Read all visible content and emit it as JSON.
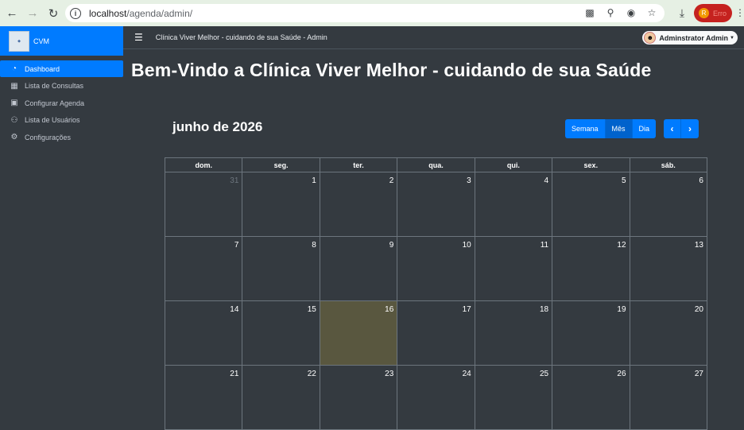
{
  "browser": {
    "url_host": "localhost",
    "url_path": "/agenda/admin/",
    "profile_initial": "R",
    "profile_label": "Erro"
  },
  "sidebar": {
    "brand": "CVM",
    "items": [
      {
        "label": "Dashboard",
        "icon": "dashboard-icon",
        "active": true
      },
      {
        "label": "Lista de Consultas",
        "icon": "calendar-icon",
        "active": false
      },
      {
        "label": "Configurar Agenda",
        "icon": "calendar-edit-icon",
        "active": false
      },
      {
        "label": "Lista de Usuários",
        "icon": "users-icon",
        "active": false
      },
      {
        "label": "Configurações",
        "icon": "gears-icon",
        "active": false
      }
    ]
  },
  "topbar": {
    "title": "Clínica Viver Melhor - cuidando de sua Saúde - Admin",
    "user_name": "Adminstrator Admin"
  },
  "page": {
    "title": "Bem-Vindo a Clínica Viver Melhor - cuidando de sua Saúde"
  },
  "calendar": {
    "title": "junho de 2026",
    "view_buttons": [
      "Semana",
      "Mês",
      "Dia"
    ],
    "active_view": "Mês",
    "weekdays": [
      "dom.",
      "seg.",
      "ter.",
      "qua.",
      "qui.",
      "sex.",
      "sáb."
    ],
    "weeks": [
      [
        {
          "d": "31",
          "other": true
        },
        {
          "d": "1"
        },
        {
          "d": "2"
        },
        {
          "d": "3"
        },
        {
          "d": "4"
        },
        {
          "d": "5"
        },
        {
          "d": "6"
        }
      ],
      [
        {
          "d": "7"
        },
        {
          "d": "8"
        },
        {
          "d": "9"
        },
        {
          "d": "10"
        },
        {
          "d": "11"
        },
        {
          "d": "12"
        },
        {
          "d": "13"
        }
      ],
      [
        {
          "d": "14"
        },
        {
          "d": "15"
        },
        {
          "d": "16",
          "today": true
        },
        {
          "d": "17"
        },
        {
          "d": "18"
        },
        {
          "d": "19"
        },
        {
          "d": "20"
        }
      ],
      [
        {
          "d": "21"
        },
        {
          "d": "22"
        },
        {
          "d": "23"
        },
        {
          "d": "24"
        },
        {
          "d": "25"
        },
        {
          "d": "26"
        },
        {
          "d": "27"
        }
      ]
    ]
  },
  "colors": {
    "accent": "#007bff",
    "today": "#59573f",
    "background": "#343a40"
  }
}
